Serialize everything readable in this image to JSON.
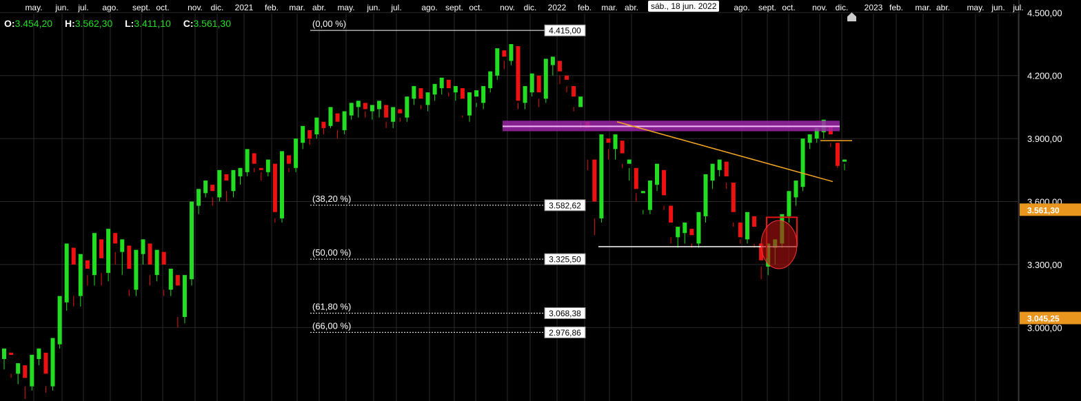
{
  "ohlc": {
    "open_label": "O:",
    "open": "3.454,20",
    "high_label": "H:",
    "high": "3.562,30",
    "low_label": "L:",
    "low": "3.411,10",
    "close_label": "C:",
    "close": "3.561,30"
  },
  "date_badge": "sáb., 18 jun. 2022",
  "colors": {
    "up": "#22dd22",
    "down": "#ee1111",
    "grid": "#2a2a2a",
    "fib_band": "#9b27a8",
    "trendline": "#f5a623",
    "badge_orange": "#e8961e"
  },
  "chart_data": {
    "type": "candlestick",
    "x_ticks": [
      "may.",
      "jun.",
      "jul.",
      "ago.",
      "sept.",
      "oct.",
      "nov.",
      "dic.",
      "2021",
      "feb.",
      "mar.",
      "abr.",
      "may.",
      "jun.",
      "jul.",
      "ago.",
      "sept.",
      "oct.",
      "nov.",
      "dic.",
      "2022",
      "feb.",
      "mar.",
      "abr.",
      "ago.",
      "sept.",
      "oct.",
      "nov.",
      "dic.",
      "2023",
      "feb.",
      "mar.",
      "abr.",
      "may.",
      "jun.",
      "jul."
    ],
    "y_ticks": [
      "4.500,00",
      "4.200,00",
      "3.900,00",
      "3.600,00",
      "3.300,00",
      "3.000,00"
    ],
    "y_tick_values": [
      4500,
      4200,
      3900,
      3600,
      3300,
      3000
    ],
    "ylim": [
      2650,
      4560
    ],
    "price_badges": [
      {
        "label": "3.561,30",
        "value": 3561.3
      },
      {
        "label": "3.045,25",
        "value": 3045.25
      }
    ],
    "fibonacci": [
      {
        "pct": "(0,00 %)",
        "price": "4.415,00",
        "value": 4415.0,
        "solid": true
      },
      {
        "pct": "(38,20 %)",
        "price": "3.582,62",
        "value": 3582.62,
        "solid": false
      },
      {
        "pct": "(50,00 %)",
        "price": "3.325,50",
        "value": 3325.5,
        "solid": false
      },
      {
        "pct": "(61,80 %)",
        "price": "3.068,38",
        "value": 3068.38,
        "solid": false
      },
      {
        "pct": "(66,00 %)",
        "price": "2.976,86",
        "value": 2976.86,
        "solid": false
      }
    ],
    "candles": [
      [
        2850,
        2900,
        2800,
        2880
      ],
      [
        2880,
        2870,
        2760,
        2780
      ],
      [
        2780,
        2830,
        2730,
        2820
      ],
      [
        2820,
        2760,
        2660,
        2720
      ],
      [
        2720,
        2870,
        2700,
        2850
      ],
      [
        2850,
        2900,
        2820,
        2880
      ],
      [
        2880,
        2780,
        2690,
        2720
      ],
      [
        2720,
        2950,
        2700,
        2920
      ],
      [
        2920,
        3150,
        2900,
        3120
      ],
      [
        3120,
        3400,
        3080,
        3380
      ],
      [
        3380,
        3300,
        3100,
        3150
      ],
      [
        3150,
        3350,
        3100,
        3320
      ],
      [
        3320,
        3280,
        3200,
        3250
      ],
      [
        3250,
        3450,
        3200,
        3420
      ],
      [
        3420,
        3330,
        3200,
        3260
      ],
      [
        3260,
        3470,
        3220,
        3450
      ],
      [
        3450,
        3400,
        3300,
        3360
      ],
      [
        3360,
        3420,
        3250,
        3390
      ],
      [
        3390,
        3280,
        3150,
        3180
      ],
      [
        3180,
        3370,
        3150,
        3350
      ],
      [
        3350,
        3420,
        3300,
        3400
      ],
      [
        3400,
        3300,
        3200,
        3250
      ],
      [
        3250,
        3370,
        3220,
        3360
      ],
      [
        3360,
        3300,
        3150,
        3180
      ],
      [
        3180,
        3280,
        3150,
        3250
      ],
      [
        3250,
        3200,
        3000,
        3050
      ],
      [
        3050,
        3250,
        3020,
        3230
      ],
      [
        3230,
        3600,
        3200,
        3580
      ],
      [
        3580,
        3660,
        3540,
        3640
      ],
      [
        3640,
        3700,
        3620,
        3680
      ],
      [
        3680,
        3650,
        3580,
        3620
      ],
      [
        3620,
        3750,
        3600,
        3730
      ],
      [
        3730,
        3700,
        3600,
        3650
      ],
      [
        3650,
        3750,
        3620,
        3720
      ],
      [
        3720,
        3760,
        3680,
        3740
      ],
      [
        3740,
        3850,
        3720,
        3830
      ],
      [
        3830,
        3780,
        3740,
        3760
      ],
      [
        3760,
        3750,
        3700,
        3740
      ],
      [
        3740,
        3800,
        3720,
        3780
      ],
      [
        3780,
        3550,
        3500,
        3520
      ],
      [
        3520,
        3840,
        3500,
        3820
      ],
      [
        3820,
        3780,
        3740,
        3760
      ],
      [
        3760,
        3900,
        3740,
        3880
      ],
      [
        3880,
        3960,
        3850,
        3940
      ],
      [
        3940,
        3900,
        3870,
        3920
      ],
      [
        3920,
        4000,
        3900,
        3980
      ],
      [
        3980,
        3950,
        3920,
        3960
      ],
      [
        3960,
        4050,
        3950,
        4020
      ],
      [
        4020,
        3980,
        3900,
        3940
      ],
      [
        3940,
        4030,
        3920,
        4010
      ],
      [
        4010,
        4070,
        3990,
        4050
      ],
      [
        4050,
        4080,
        4000,
        4070
      ],
      [
        4070,
        4040,
        4000,
        4030
      ],
      [
        4030,
        4060,
        3990,
        4040
      ],
      [
        4040,
        4080,
        4000,
        4060
      ],
      [
        4060,
        4000,
        3950,
        3980
      ],
      [
        3980,
        4050,
        3950,
        4040
      ],
      [
        4040,
        4020,
        3980,
        4000
      ],
      [
        4000,
        4100,
        3980,
        4090
      ],
      [
        4090,
        4150,
        4060,
        4140
      ],
      [
        4140,
        4090,
        4040,
        4060
      ],
      [
        4060,
        4120,
        4030,
        4110
      ],
      [
        4110,
        4160,
        4080,
        4140
      ],
      [
        4140,
        4190,
        4110,
        4180
      ],
      [
        4180,
        4140,
        4100,
        4120
      ],
      [
        4120,
        4150,
        4080,
        4140
      ],
      [
        4140,
        4090,
        4000,
        4010
      ],
      [
        4010,
        4120,
        3980,
        4100
      ],
      [
        4100,
        4130,
        4050,
        4070
      ],
      [
        4070,
        4150,
        4040,
        4140
      ],
      [
        4140,
        4220,
        4120,
        4200
      ],
      [
        4200,
        4330,
        4180,
        4320
      ],
      [
        4320,
        4290,
        4230,
        4270
      ],
      [
        4270,
        4350,
        4250,
        4340
      ],
      [
        4340,
        4080,
        4040,
        4070
      ],
      [
        4070,
        4150,
        4040,
        4120
      ],
      [
        4120,
        4210,
        4100,
        4200
      ],
      [
        4200,
        4120,
        4050,
        4090
      ],
      [
        4090,
        4280,
        4070,
        4250
      ],
      [
        4250,
        4290,
        4200,
        4270
      ],
      [
        4270,
        4220,
        4160,
        4200
      ],
      [
        4200,
        4180,
        4120,
        4150
      ],
      [
        4150,
        4100,
        4030,
        4050
      ],
      [
        4050,
        4100,
        3950,
        3980
      ],
      [
        3980,
        3950,
        3750,
        3800
      ],
      [
        3800,
        3600,
        3440,
        3520
      ],
      [
        3520,
        3920,
        3500,
        3900
      ],
      [
        3900,
        3880,
        3800,
        3850
      ],
      [
        3850,
        3920,
        3800,
        3890
      ],
      [
        3890,
        3830,
        3760,
        3780
      ],
      [
        3780,
        3800,
        3700,
        3760
      ],
      [
        3760,
        3660,
        3600,
        3640
      ],
      [
        3640,
        3650,
        3540,
        3560
      ],
      [
        3560,
        3700,
        3540,
        3680
      ],
      [
        3680,
        3780,
        3650,
        3750
      ],
      [
        3750,
        3630,
        3560,
        3580
      ],
      [
        3580,
        3500,
        3400,
        3430
      ],
      [
        3430,
        3480,
        3380,
        3450
      ],
      [
        3450,
        3500,
        3400,
        3470
      ],
      [
        3470,
        3440,
        3380,
        3400
      ],
      [
        3400,
        3550,
        3380,
        3530
      ],
      [
        3530,
        3730,
        3500,
        3700
      ],
      [
        3700,
        3780,
        3660,
        3750
      ],
      [
        3750,
        3800,
        3720,
        3790
      ],
      [
        3790,
        3720,
        3660,
        3690
      ],
      [
        3690,
        3550,
        3480,
        3500
      ],
      [
        3500,
        3430,
        3400,
        3420
      ],
      [
        3420,
        3550,
        3400,
        3530
      ],
      [
        3530,
        3480,
        3380,
        3400
      ],
      [
        3400,
        3320,
        3230,
        3290
      ],
      [
        3290,
        3400,
        3250,
        3380
      ],
      [
        3380,
        3420,
        3300,
        3400
      ],
      [
        3400,
        3540,
        3380,
        3530
      ],
      [
        3530,
        3650,
        3500,
        3620
      ],
      [
        3620,
        3700,
        3580,
        3670
      ],
      [
        3670,
        3900,
        3650,
        3880
      ],
      [
        3880,
        3920,
        3850,
        3900
      ],
      [
        3900,
        3950,
        3880,
        3930
      ],
      [
        3930,
        3990,
        3900,
        3960
      ],
      [
        3960,
        3920,
        3860,
        3880
      ],
      [
        3880,
        3770,
        3760,
        3790
      ],
      [
        3790,
        3800,
        3750,
        3780
      ]
    ]
  }
}
